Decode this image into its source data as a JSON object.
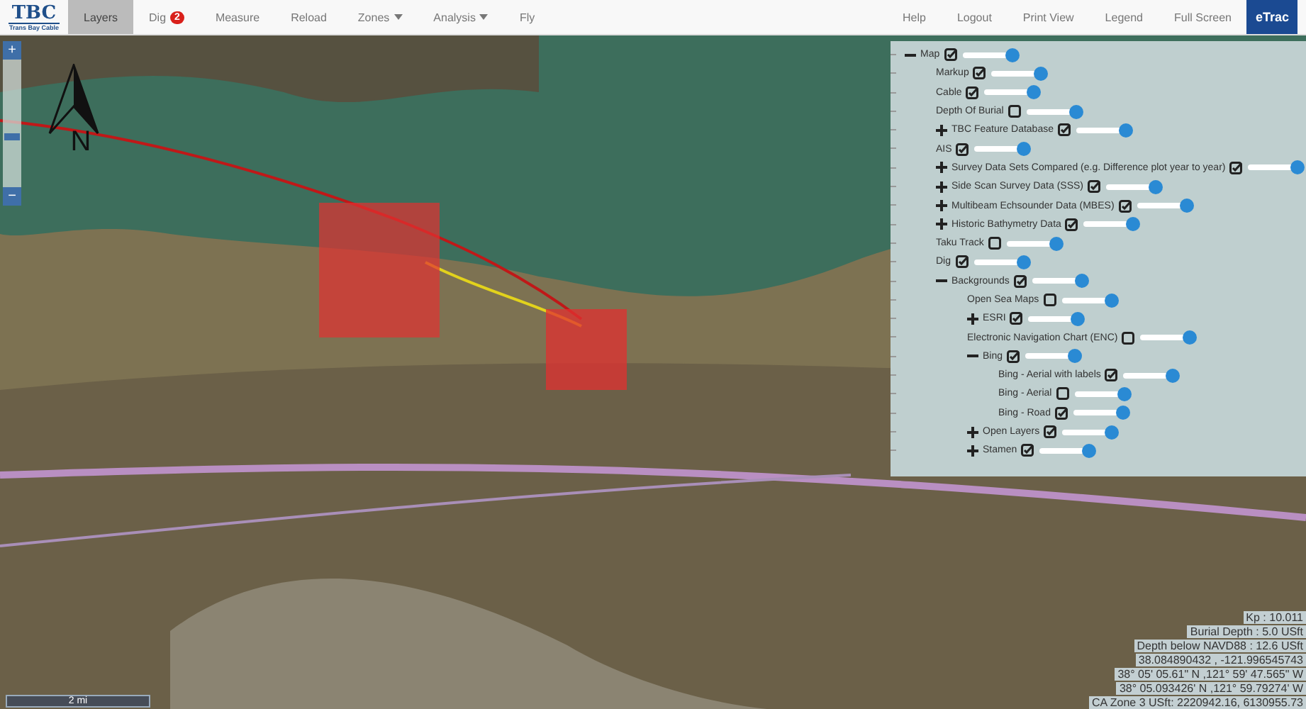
{
  "brand": {
    "logo": "TBC",
    "subtitle": "Trans Bay Cable"
  },
  "nav_left": [
    {
      "label": "Layers",
      "selected": true
    },
    {
      "label": "Dig",
      "selected": false,
      "badge": "2"
    },
    {
      "label": "Measure",
      "selected": false
    },
    {
      "label": "Reload",
      "selected": false
    },
    {
      "label": "Zones",
      "selected": false,
      "dropdown": true
    },
    {
      "label": "Analysis",
      "selected": false,
      "dropdown": true
    },
    {
      "label": "Fly",
      "selected": false
    }
  ],
  "nav_right": [
    "Help",
    "Logout",
    "Print View",
    "Legend",
    "Full Screen"
  ],
  "partner_logo": "eTrac",
  "map": {
    "north_label": "N",
    "scale": "2 mi",
    "zoom_in": "+",
    "zoom_out": "−",
    "zoom": {
      "level": 0.4
    }
  },
  "layers": [
    {
      "label": "Map",
      "checked": true,
      "level": 1,
      "expanded": true,
      "children": [
        {
          "label": "Markup",
          "checked": true,
          "level": 1
        },
        {
          "label": "Cable",
          "checked": true,
          "level": 1
        },
        {
          "label": "Depth Of Burial",
          "checked": false,
          "level": 1
        },
        {
          "label": "TBC Feature Database",
          "checked": true,
          "level": 1,
          "expanded": false
        },
        {
          "label": "AIS",
          "checked": true,
          "level": 1
        },
        {
          "label": "Survey Data Sets Compared (e.g. Difference plot year to year)",
          "checked": true,
          "level": 1,
          "expanded": false
        },
        {
          "label": "Side Scan Survey Data (SSS)",
          "checked": true,
          "level": 1,
          "expanded": false
        },
        {
          "label": "Multibeam Echsounder Data (MBES)",
          "checked": true,
          "level": 1,
          "expanded": false
        },
        {
          "label": "Historic Bathymetry Data",
          "checked": true,
          "level": 1,
          "expanded": false
        },
        {
          "label": "Taku Track",
          "checked": false,
          "level": 1
        },
        {
          "label": "Dig",
          "checked": true,
          "level": 1
        },
        {
          "label": "Backgrounds",
          "checked": true,
          "level": 1,
          "expanded": true,
          "children": [
            {
              "label": "Open Sea Maps",
              "checked": false,
              "level": 1
            },
            {
              "label": "ESRI",
              "checked": true,
              "level": 1,
              "expanded": false
            },
            {
              "label": "Electronic Navigation Chart (ENC)",
              "checked": false,
              "level": 1
            },
            {
              "label": "Bing",
              "checked": true,
              "level": 1,
              "expanded": true,
              "children": [
                {
                  "label": "Bing - Aerial with labels",
                  "checked": true,
                  "level": 1
                },
                {
                  "label": "Bing - Aerial",
                  "checked": false,
                  "level": 1
                },
                {
                  "label": "Bing - Road",
                  "checked": true,
                  "level": 1
                }
              ]
            },
            {
              "label": "Open Layers",
              "checked": true,
              "level": 1,
              "expanded": false
            },
            {
              "label": "Stamen",
              "checked": true,
              "level": 1,
              "expanded": false
            }
          ]
        }
      ]
    }
  ],
  "readouts": [
    "Kp : 10.011",
    "Burial Depth : 5.0 USft",
    "Depth below NAVD88 : 12.6 USft",
    "38.084890432 , -121.996545743",
    "38° 05' 05.61\" N ,121° 59' 47.565\" W",
    "38° 05.093426' N ,121° 59.79274' W",
    "CA Zone 3 USft: 2220942.16, 6130955.73"
  ]
}
